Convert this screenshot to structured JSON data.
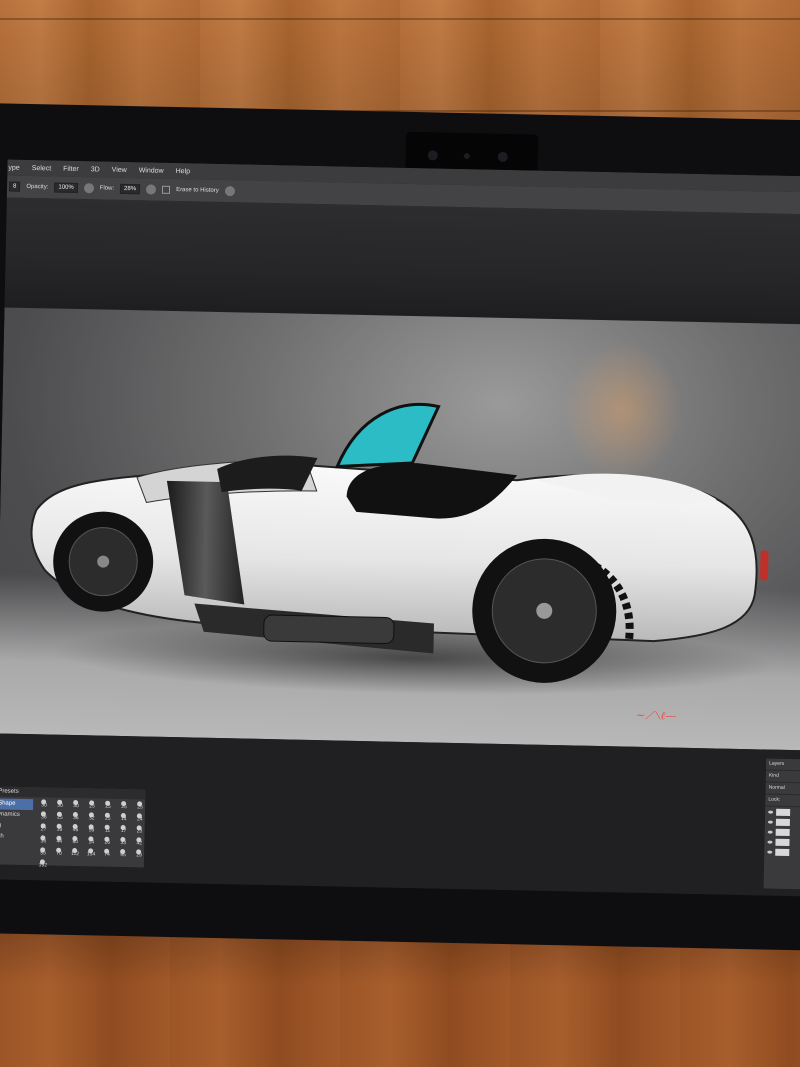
{
  "menu": [
    "ype",
    "Select",
    "Filter",
    "3D",
    "View",
    "Window",
    "Help"
  ],
  "options": {
    "opacity_label": "Opacity:",
    "opacity_value": "100%",
    "flow_label": "Flow:",
    "flow_value": "28%",
    "erase_history_label": "Erase to History"
  },
  "brush_panel": {
    "title": "Presets",
    "items": [
      "Shape",
      "ynamics",
      "g",
      "sh"
    ],
    "active_item": "Shape",
    "sizes": [
      "30",
      "30",
      "30",
      "25",
      "25",
      "25",
      "25",
      "36",
      "25",
      "36",
      "32",
      "25",
      "14",
      "24",
      "27",
      "39",
      "46",
      "59",
      "11",
      "17",
      "23",
      "36",
      "44",
      "60",
      "14",
      "26",
      "33",
      "42",
      "55",
      "70",
      "112",
      "134",
      "74",
      "95",
      "29",
      "192"
    ]
  },
  "layers_panel": {
    "title": "Layers",
    "kind_label": "Kind",
    "blend_mode": "Normal",
    "lock_label": "Lock:"
  },
  "colors": {
    "accent": "#4b6fa6",
    "windshield": "#2bbcc6",
    "signature": "#e0504a"
  }
}
